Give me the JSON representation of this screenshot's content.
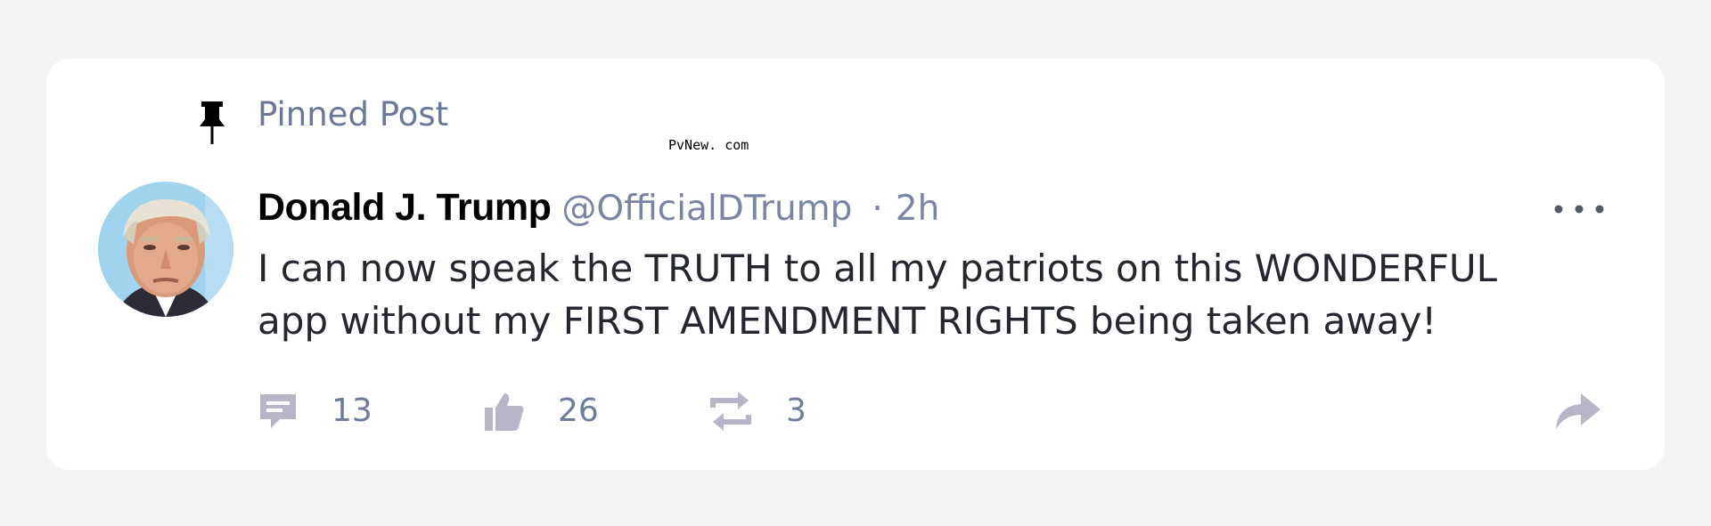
{
  "pinned": {
    "label": "Pinned Post",
    "icon": "pin-icon"
  },
  "watermark": "PvNew. com",
  "post": {
    "author": {
      "display_name": "Donald J. Trump",
      "handle": "@OfficialDTrump"
    },
    "separator": "·",
    "time": "2h",
    "body": "I can now speak the TRUTH to all my patriots on this WONDERFUL app without my FIRST AMENDMENT RIGHTS being taken away!",
    "actions": {
      "reply": {
        "icon": "comment-icon",
        "count": "13"
      },
      "like": {
        "icon": "thumbs-up-icon",
        "count": "26"
      },
      "repost": {
        "icon": "repost-icon",
        "count": "3"
      },
      "share": {
        "icon": "share-icon"
      },
      "more": {
        "icon": "more-icon"
      }
    }
  },
  "colors": {
    "background": "#f4f4f4",
    "card": "#ffffff",
    "muted_text": "#7a85a6",
    "icon": "#b6b6c8",
    "body_text": "#25272e"
  }
}
